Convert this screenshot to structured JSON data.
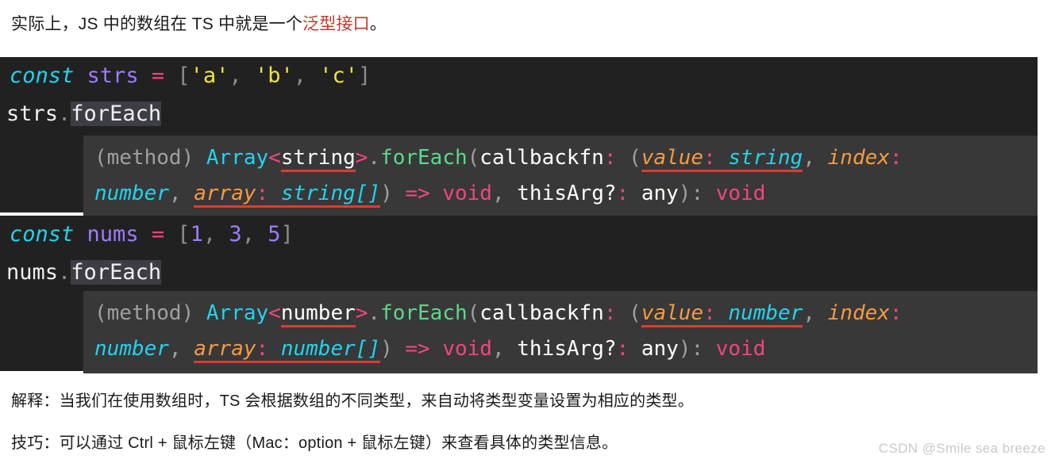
{
  "intro": {
    "before": "实际上，JS 中的数组在 TS 中就是一个",
    "highlight": "泛型接口",
    "after": "。"
  },
  "code_blocks": [
    {
      "id": "strs",
      "declaration": {
        "keyword": "const",
        "name": "strs",
        "operator": "=",
        "open_bracket": "[",
        "items": [
          "'a'",
          "'b'",
          "'c'"
        ],
        "separator": ", ",
        "close_bracket": "]"
      },
      "usage": {
        "object": "strs",
        "dot": ".",
        "member": "forEach"
      },
      "tooltip": {
        "kind": "(method)",
        "owner": "Array",
        "angle_open": "<",
        "generic": "string",
        "angle_close": ">",
        "dot": ".",
        "method": "forEach",
        "paren_open": "(",
        "callback_name": "callbackfn",
        "colon": ":",
        "cb_paren_open": "(",
        "params": [
          {
            "name": "value",
            "type": "string",
            "underlined": true
          },
          {
            "name": "index",
            "type": "number",
            "underlined": false
          },
          {
            "name": "array",
            "type": "string[]",
            "underlined": true
          }
        ],
        "cb_paren_close": ")",
        "arrow": "=>",
        "cb_return": "void",
        "this_arg": "thisArg?",
        "this_arg_type": "any",
        "paren_close": ")",
        "return_type": "void"
      }
    },
    {
      "id": "nums",
      "declaration": {
        "keyword": "const",
        "name": "nums",
        "operator": "=",
        "open_bracket": "[",
        "items": [
          "1",
          "3",
          "5"
        ],
        "separator": ", ",
        "close_bracket": "]"
      },
      "usage": {
        "object": "nums",
        "dot": ".",
        "member": "forEach"
      },
      "tooltip": {
        "kind": "(method)",
        "owner": "Array",
        "angle_open": "<",
        "generic": "number",
        "angle_close": ">",
        "dot": ".",
        "method": "forEach",
        "paren_open": "(",
        "callback_name": "callbackfn",
        "colon": ":",
        "cb_paren_open": "(",
        "params": [
          {
            "name": "value",
            "type": "number",
            "underlined": true
          },
          {
            "name": "index",
            "type": "number",
            "underlined": false
          },
          {
            "name": "array",
            "type": "number[]",
            "underlined": true
          }
        ],
        "cb_paren_close": ")",
        "arrow": "=>",
        "cb_return": "void",
        "this_arg": "thisArg?",
        "this_arg_type": "any",
        "paren_close": ")",
        "return_type": "void"
      }
    }
  ],
  "explanation": "解释：当我们在使用数组时，TS 会根据数组的不同类型，来自动将类型变量设置为相应的类型。",
  "tip": "技巧：可以通过 Ctrl + 鼠标左键（Mac：option + 鼠标左键）来查看具体的类型信息。",
  "watermark": "CSDN @Smile sea breeze",
  "colors": {
    "code_bg": "#212121",
    "tooltip_bg": "#383838",
    "accent_red": "#c0392b",
    "underline_red": "#e03a2f",
    "keyword_cyan": "#22d3ee",
    "variable_purple": "#9d7cff",
    "operator_pink": "#f2457f",
    "string_yellow": "#f2e53c",
    "method_green": "#5bd98a",
    "param_orange": "#f59b42"
  }
}
